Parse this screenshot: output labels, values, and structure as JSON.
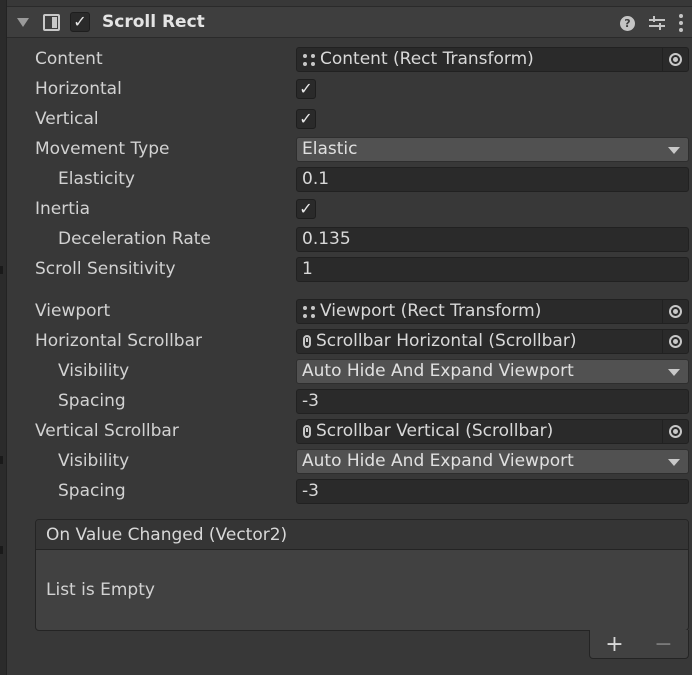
{
  "component": {
    "title": "Scroll Rect",
    "enabled_mark": "✓",
    "help_glyph": "?"
  },
  "fields": {
    "content": {
      "label": "Content",
      "value": "Content (Rect Transform)"
    },
    "horizontal": {
      "label": "Horizontal",
      "checked": "✓"
    },
    "vertical": {
      "label": "Vertical",
      "checked": "✓"
    },
    "movement_type": {
      "label": "Movement Type",
      "value": "Elastic"
    },
    "elasticity": {
      "label": "Elasticity",
      "value": "0.1"
    },
    "inertia": {
      "label": "Inertia",
      "checked": "✓"
    },
    "deceleration_rate": {
      "label": "Deceleration Rate",
      "value": "0.135"
    },
    "scroll_sensitivity": {
      "label": "Scroll Sensitivity",
      "value": "1"
    },
    "viewport": {
      "label": "Viewport",
      "value": "Viewport (Rect Transform)"
    },
    "horizontal_scrollbar": {
      "label": "Horizontal Scrollbar",
      "value": "Scrollbar Horizontal (Scrollbar)"
    },
    "h_visibility": {
      "label": "Visibility",
      "value": "Auto Hide And Expand Viewport"
    },
    "h_spacing": {
      "label": "Spacing",
      "value": "-3"
    },
    "vertical_scrollbar": {
      "label": "Vertical Scrollbar",
      "value": "Scrollbar Vertical (Scrollbar)"
    },
    "v_visibility": {
      "label": "Visibility",
      "value": "Auto Hide And Expand Viewport"
    },
    "v_spacing": {
      "label": "Spacing",
      "value": "-3"
    }
  },
  "event": {
    "title": "On Value Changed (Vector2)",
    "empty_text": "List is Empty",
    "add_label": "+",
    "remove_label": "−"
  }
}
